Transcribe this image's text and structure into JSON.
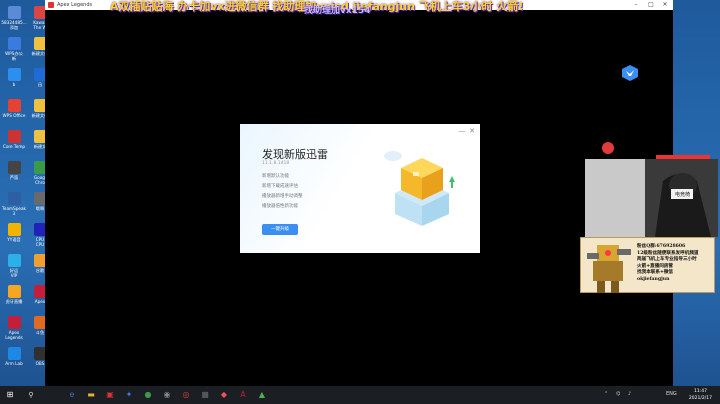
{
  "desktop": {
    "icons": [
      {
        "label": "58324485...",
        "sub": "添加",
        "color": "#5b8bd6"
      },
      {
        "label": "Kawaii",
        "sub": "The W",
        "color": "#d44"
      },
      {
        "label": "WPS办公",
        "sub": "新",
        "color": "#3b7be0"
      },
      {
        "label": "新建文件",
        "sub": "",
        "color": "#f0c040"
      },
      {
        "label": "b",
        "sub": "",
        "color": "#2c8ff0"
      },
      {
        "label": "迅",
        "sub": "",
        "color": "#1f6ad6"
      },
      {
        "label": "WPS Office",
        "sub": "",
        "color": "#e34234"
      },
      {
        "label": "新建文件",
        "sub": "",
        "color": "#f0c040"
      },
      {
        "label": "Core Temp",
        "sub": "",
        "color": "#c33"
      },
      {
        "label": "新建文",
        "sub": "",
        "color": "#f0c040"
      },
      {
        "label": "芦笛",
        "sub": "",
        "color": "#444"
      },
      {
        "label": "Googl",
        "sub": "Chro",
        "color": "#3a9a4a"
      },
      {
        "label": "TeamSpeak",
        "sub": "3",
        "color": "#2d5fa5"
      },
      {
        "label": "哦啊",
        "sub": "",
        "color": "#6a6a6a"
      },
      {
        "label": "YY语音",
        "sub": "",
        "color": "#f2b400"
      },
      {
        "label": "CPU",
        "sub": "CPU",
        "color": "#22b"
      },
      {
        "label": "好运",
        "sub": "VIP",
        "color": "#2cb0e8"
      },
      {
        "label": "谷歌",
        "sub": "",
        "color": "#f0a030"
      },
      {
        "label": "虎牙直播",
        "sub": "",
        "color": "#f5a623"
      },
      {
        "label": "Apex",
        "sub": "",
        "color": "#c41e3a"
      },
      {
        "label": "Apex",
        "sub": "Legends",
        "color": "#c41e3a"
      },
      {
        "label": "斗鱼",
        "sub": "",
        "color": "#e06a22"
      },
      {
        "label": "Arm Lab",
        "sub": "",
        "color": "#1e88e5"
      },
      {
        "label": "OBS",
        "sub": "",
        "color": "#303030"
      }
    ]
  },
  "window": {
    "title": "Apex Legends",
    "minimize": "–",
    "maximize": "□",
    "close": "✕"
  },
  "overlay": {
    "ticker": "A双插贴贴海 办卡加vx进微信群 找助理加vxisd jiefangjun 飞机上车3小时 火箭!",
    "ticker2": "找助理加vx154"
  },
  "dialog": {
    "title": "发现新版迅雷",
    "version": "11.1.8.1418",
    "features": [
      "新增默认功能",
      "新增下载成速评估",
      "播放器新增手动调整",
      "播放器倍性新功能"
    ],
    "upgrade_label": "一键升级",
    "minimize": "—",
    "close": "✕"
  },
  "streamer": {
    "banner_text": [
      "粉丝Q群:676928606",
      "12级粉丝随便联系发呼机频道",
      "两届飞机上车专业指导三小时",
      "火箭+直播间房管",
      "找我本联系+微信",
      "okjiefangjun"
    ],
    "webcam_caption": "电竞椅"
  },
  "taskbar": {
    "start": "⊞",
    "search": "⚲",
    "apps": [
      {
        "name": "edge",
        "glyph": "e",
        "color": "#3277bc"
      },
      {
        "name": "explorer",
        "glyph": "▬",
        "color": "#e8b030"
      },
      {
        "name": "app-red",
        "glyph": "▣",
        "color": "#d33"
      },
      {
        "name": "xunlei",
        "glyph": "✦",
        "color": "#3b7be0"
      },
      {
        "name": "chrome",
        "glyph": "●",
        "color": "#3a9a4a"
      },
      {
        "name": "app-grey",
        "glyph": "◉",
        "color": "#888"
      },
      {
        "name": "netease",
        "glyph": "◎",
        "color": "#e23b3b"
      },
      {
        "name": "app-dark",
        "glyph": "■",
        "color": "#555"
      },
      {
        "name": "app-red2",
        "glyph": "◆",
        "color": "#e55"
      },
      {
        "name": "apex",
        "glyph": "A",
        "color": "#c41e3a"
      },
      {
        "name": "app-green",
        "glyph": "▲",
        "color": "#4caf50"
      }
    ],
    "lang": "ENG",
    "time": "11:47",
    "date": "2021/2/17"
  }
}
